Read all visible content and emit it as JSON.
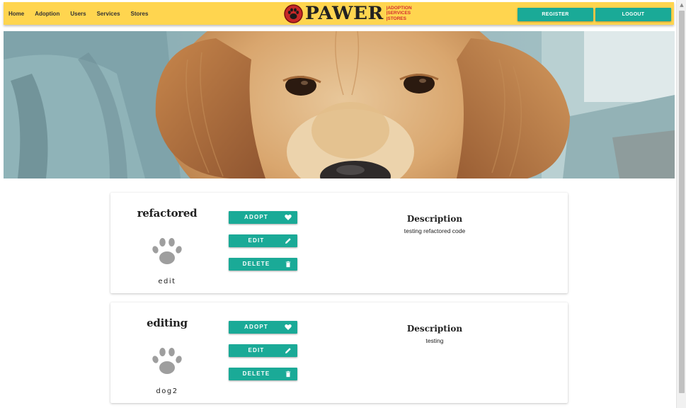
{
  "nav": {
    "links": [
      "Home",
      "Adoption",
      "Users",
      "Services",
      "Stores"
    ],
    "brand": {
      "name": "PAWER",
      "subtitle": [
        "|ADOPTION",
        "|SERVICES",
        "|STORES"
      ],
      "logo_icon": "paw-logo-icon"
    },
    "register_label": "REGISTER",
    "logout_label": "LOGOUT"
  },
  "hero": {
    "image": "golden-retriever-puppy-photo"
  },
  "colors": {
    "navbar": "#ffd54f",
    "accent": "#1aaa97",
    "brand_red": "#d32f2f",
    "paw_gray": "#9e9e9e"
  },
  "pets": [
    {
      "name": "refactored",
      "breed": "edit",
      "icon": "paw-icon",
      "adopt_label": "ADOPT",
      "edit_label": "EDIT",
      "delete_label": "DELETE",
      "description_title": "Description",
      "description": "testing refactored code"
    },
    {
      "name": "editing",
      "breed": "dog2",
      "icon": "paw-icon",
      "adopt_label": "ADOPT",
      "edit_label": "EDIT",
      "delete_label": "DELETE",
      "description_title": "Description",
      "description": "testing"
    }
  ]
}
